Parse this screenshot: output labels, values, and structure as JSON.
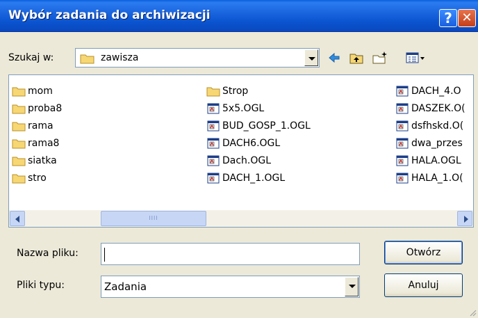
{
  "window": {
    "title": "Wybór zadania do archiwizacji"
  },
  "titlebar_buttons": {
    "help_label": "?",
    "close_label": "✕"
  },
  "lookin": {
    "label": "Szukaj w:",
    "value": "zawisza"
  },
  "toolbar": {
    "back_icon": "back-arrow-icon",
    "up_icon": "up-folder-icon",
    "new_folder_icon": "new-folder-icon",
    "view_icon": "view-menu-icon"
  },
  "files": {
    "col1": [
      {
        "name": "mom",
        "type": "folder"
      },
      {
        "name": "proba8",
        "type": "folder"
      },
      {
        "name": "rama",
        "type": "folder"
      },
      {
        "name": "rama8",
        "type": "folder"
      },
      {
        "name": "siatka",
        "type": "folder"
      },
      {
        "name": "stro",
        "type": "folder"
      }
    ],
    "col2": [
      {
        "name": "Strop",
        "type": "folder"
      },
      {
        "name": "5x5.OGL",
        "type": "file"
      },
      {
        "name": "BUD_GOSP_1.OGL",
        "type": "file"
      },
      {
        "name": "DACH6.OGL",
        "type": "file"
      },
      {
        "name": "Dach.OGL",
        "type": "file"
      },
      {
        "name": "DACH_1.OGL",
        "type": "file"
      }
    ],
    "col3": [
      {
        "name": "DACH_4.O",
        "type": "file"
      },
      {
        "name": "DASZEK.O(",
        "type": "file"
      },
      {
        "name": "dsfhskd.O(",
        "type": "file"
      },
      {
        "name": "dwa_przes",
        "type": "file"
      },
      {
        "name": "HALA.OGL",
        "type": "file"
      },
      {
        "name": "HALA_1.O(",
        "type": "file"
      }
    ]
  },
  "scrollbar": {
    "thumb_grip": "IIII"
  },
  "filename": {
    "label": "Nazwa pliku:",
    "value": ""
  },
  "filetype": {
    "label": "Pliki typu:",
    "value": "Zadania"
  },
  "buttons": {
    "open_label": "Otwórz",
    "cancel_label": "Anuluj"
  },
  "colors": {
    "titlebar": "#0b54d0",
    "window_bg": "#ece9d8",
    "folder": "#f2c94c"
  }
}
